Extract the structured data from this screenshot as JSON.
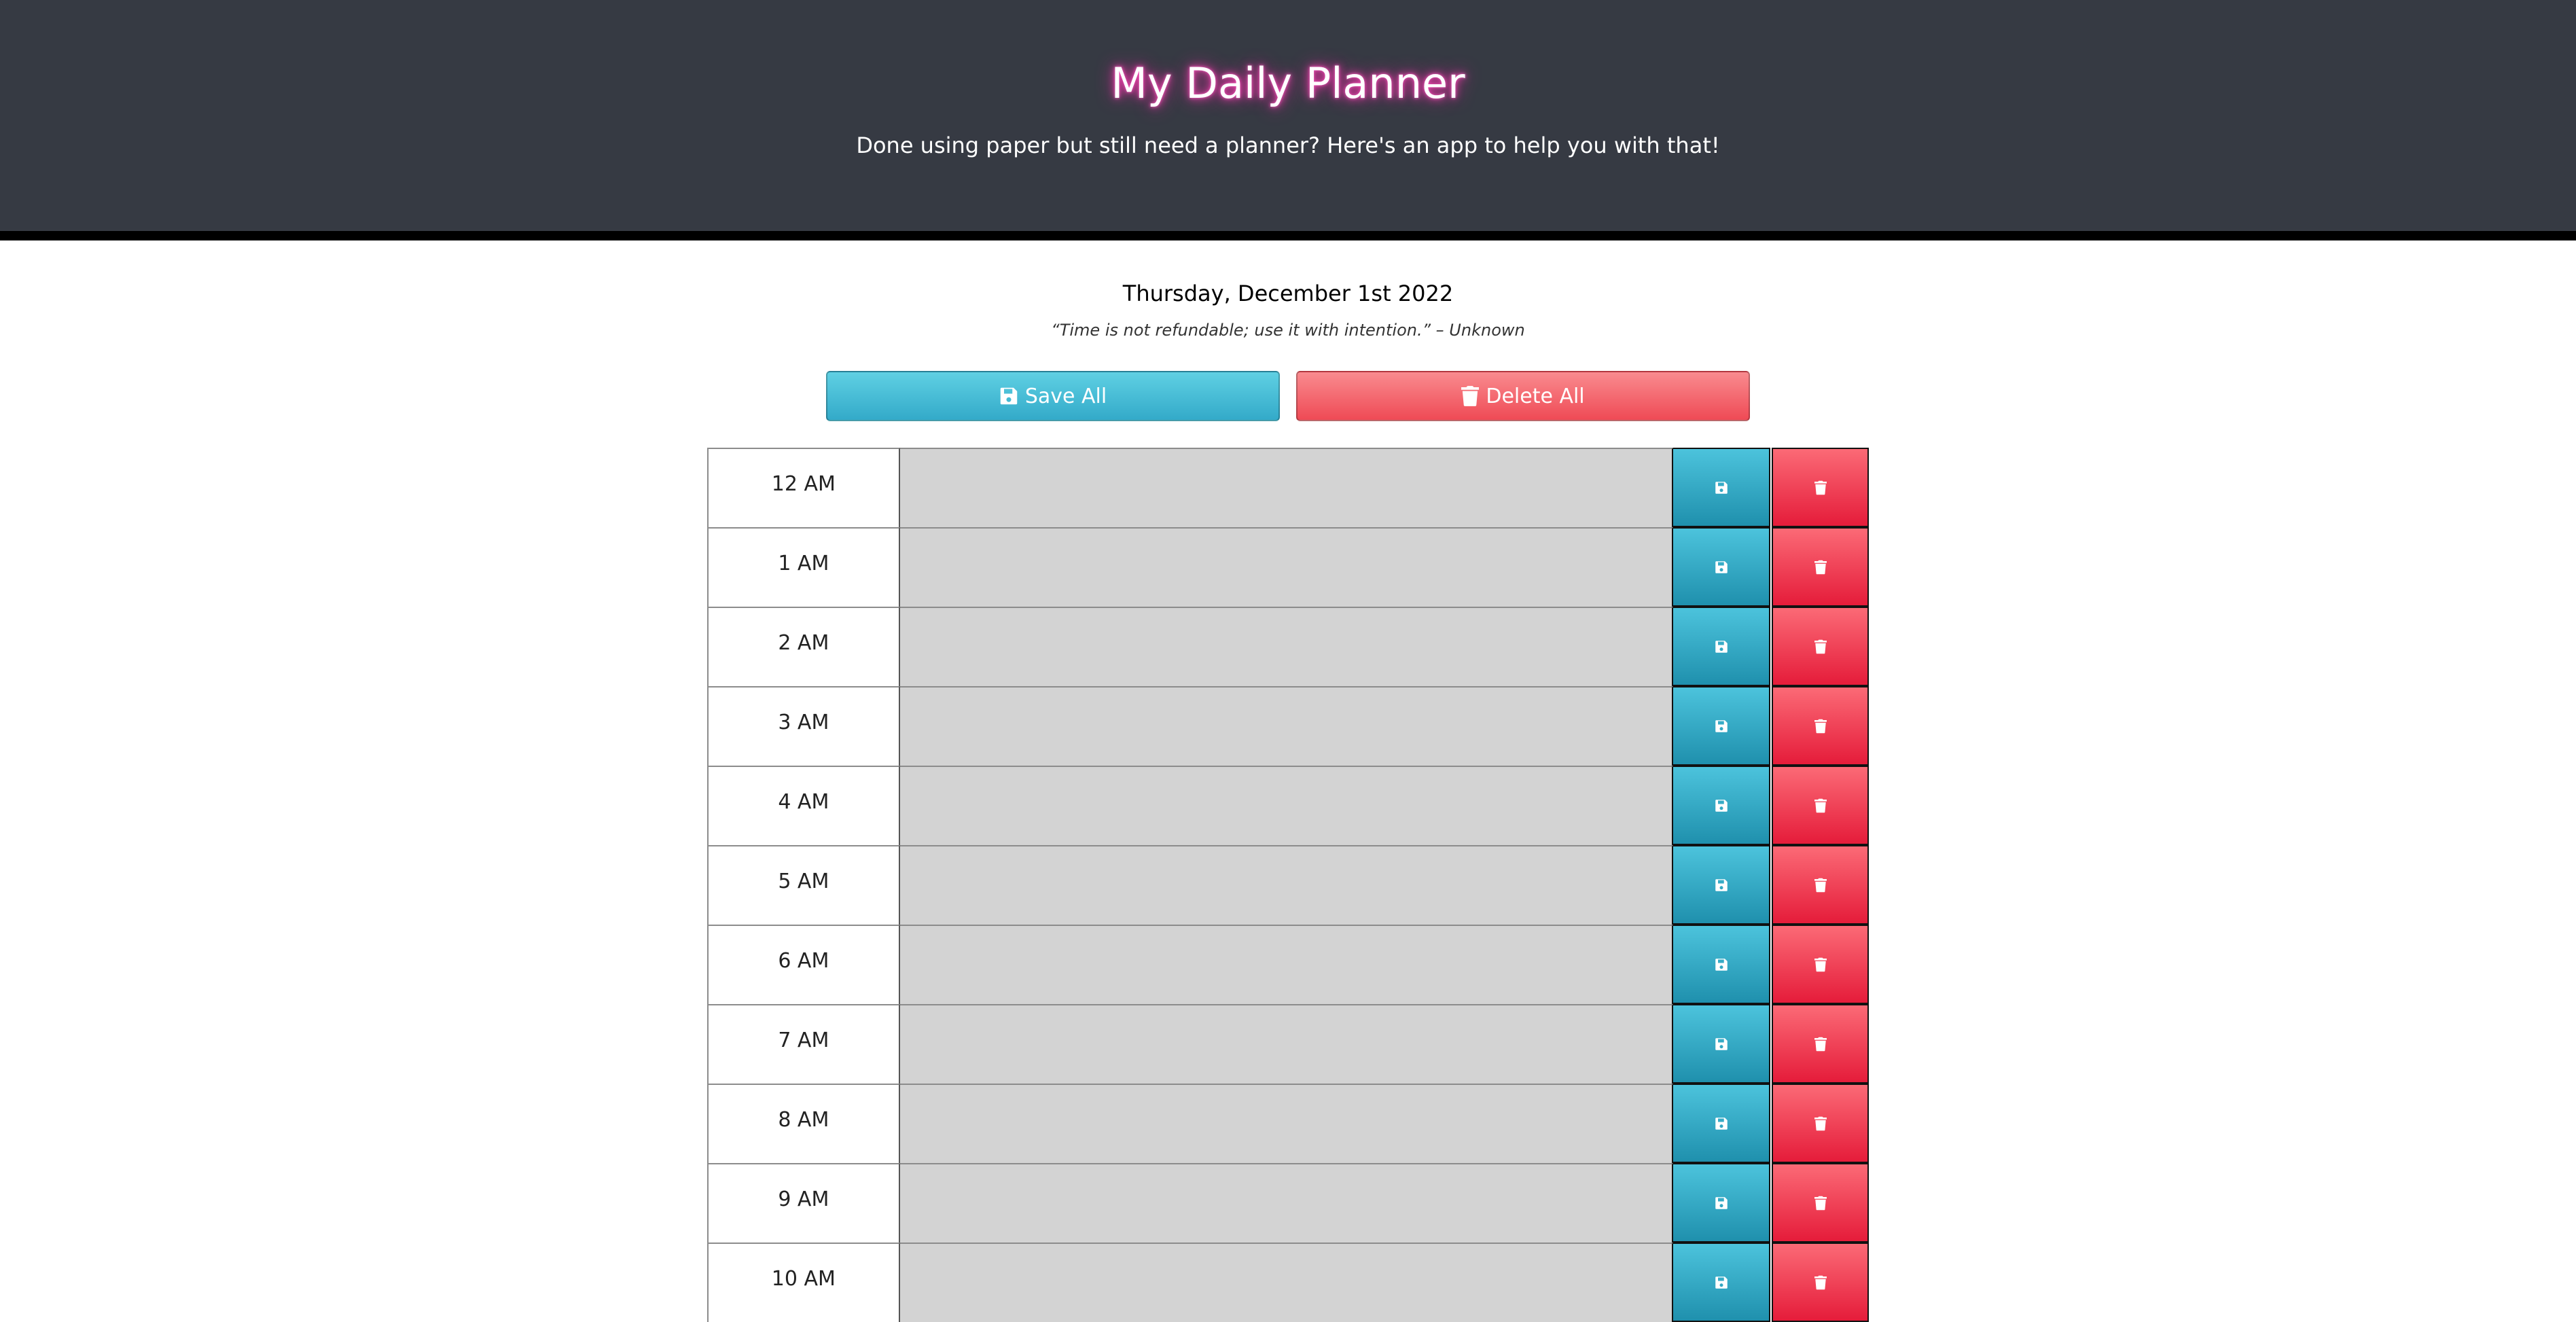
{
  "header": {
    "title": "My Daily Planner",
    "subtitle": "Done using paper but still need a planner? Here's an app to help you with that!"
  },
  "date": "Thursday, December 1st 2022",
  "quote": "“Time is not refundable; use it with intention.” – Unknown",
  "actions": {
    "save_all_label": "Save All",
    "delete_all_label": "Delete All",
    "save_icon": "floppy-disk-icon",
    "delete_icon": "trash-icon"
  },
  "colors": {
    "header_bg": "#363a43",
    "title_glow": "#ff3fb2",
    "save": "#33aac9",
    "delete": "#ef4a55",
    "task_bg": "#d3d3d3"
  },
  "hours": [
    {
      "label": "12 AM",
      "task": ""
    },
    {
      "label": "1 AM",
      "task": ""
    },
    {
      "label": "2 AM",
      "task": ""
    },
    {
      "label": "3 AM",
      "task": ""
    },
    {
      "label": "4 AM",
      "task": ""
    },
    {
      "label": "5 AM",
      "task": ""
    },
    {
      "label": "6 AM",
      "task": ""
    },
    {
      "label": "7 AM",
      "task": ""
    },
    {
      "label": "8 AM",
      "task": ""
    },
    {
      "label": "9 AM",
      "task": ""
    },
    {
      "label": "10 AM",
      "task": ""
    }
  ]
}
